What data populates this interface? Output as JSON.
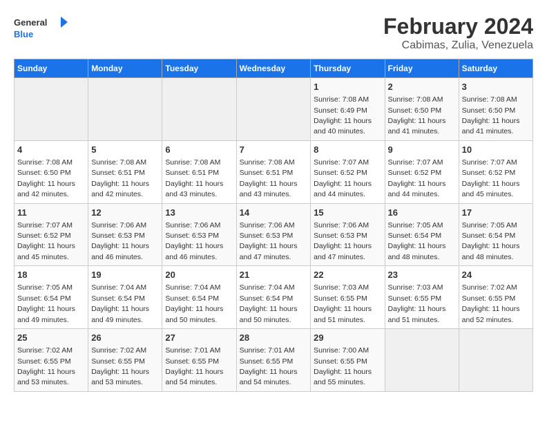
{
  "header": {
    "logo_line1": "General",
    "logo_line2": "Blue",
    "title": "February 2024",
    "subtitle": "Cabimas, Zulia, Venezuela"
  },
  "days_of_week": [
    "Sunday",
    "Monday",
    "Tuesday",
    "Wednesday",
    "Thursday",
    "Friday",
    "Saturday"
  ],
  "weeks": [
    [
      {
        "day": "",
        "info": ""
      },
      {
        "day": "",
        "info": ""
      },
      {
        "day": "",
        "info": ""
      },
      {
        "day": "",
        "info": ""
      },
      {
        "day": "1",
        "info": "Sunrise: 7:08 AM\nSunset: 6:49 PM\nDaylight: 11 hours and 40 minutes."
      },
      {
        "day": "2",
        "info": "Sunrise: 7:08 AM\nSunset: 6:50 PM\nDaylight: 11 hours and 41 minutes."
      },
      {
        "day": "3",
        "info": "Sunrise: 7:08 AM\nSunset: 6:50 PM\nDaylight: 11 hours and 41 minutes."
      }
    ],
    [
      {
        "day": "4",
        "info": "Sunrise: 7:08 AM\nSunset: 6:50 PM\nDaylight: 11 hours and 42 minutes."
      },
      {
        "day": "5",
        "info": "Sunrise: 7:08 AM\nSunset: 6:51 PM\nDaylight: 11 hours and 42 minutes."
      },
      {
        "day": "6",
        "info": "Sunrise: 7:08 AM\nSunset: 6:51 PM\nDaylight: 11 hours and 43 minutes."
      },
      {
        "day": "7",
        "info": "Sunrise: 7:08 AM\nSunset: 6:51 PM\nDaylight: 11 hours and 43 minutes."
      },
      {
        "day": "8",
        "info": "Sunrise: 7:07 AM\nSunset: 6:52 PM\nDaylight: 11 hours and 44 minutes."
      },
      {
        "day": "9",
        "info": "Sunrise: 7:07 AM\nSunset: 6:52 PM\nDaylight: 11 hours and 44 minutes."
      },
      {
        "day": "10",
        "info": "Sunrise: 7:07 AM\nSunset: 6:52 PM\nDaylight: 11 hours and 45 minutes."
      }
    ],
    [
      {
        "day": "11",
        "info": "Sunrise: 7:07 AM\nSunset: 6:52 PM\nDaylight: 11 hours and 45 minutes."
      },
      {
        "day": "12",
        "info": "Sunrise: 7:06 AM\nSunset: 6:53 PM\nDaylight: 11 hours and 46 minutes."
      },
      {
        "day": "13",
        "info": "Sunrise: 7:06 AM\nSunset: 6:53 PM\nDaylight: 11 hours and 46 minutes."
      },
      {
        "day": "14",
        "info": "Sunrise: 7:06 AM\nSunset: 6:53 PM\nDaylight: 11 hours and 47 minutes."
      },
      {
        "day": "15",
        "info": "Sunrise: 7:06 AM\nSunset: 6:53 PM\nDaylight: 11 hours and 47 minutes."
      },
      {
        "day": "16",
        "info": "Sunrise: 7:05 AM\nSunset: 6:54 PM\nDaylight: 11 hours and 48 minutes."
      },
      {
        "day": "17",
        "info": "Sunrise: 7:05 AM\nSunset: 6:54 PM\nDaylight: 11 hours and 48 minutes."
      }
    ],
    [
      {
        "day": "18",
        "info": "Sunrise: 7:05 AM\nSunset: 6:54 PM\nDaylight: 11 hours and 49 minutes."
      },
      {
        "day": "19",
        "info": "Sunrise: 7:04 AM\nSunset: 6:54 PM\nDaylight: 11 hours and 49 minutes."
      },
      {
        "day": "20",
        "info": "Sunrise: 7:04 AM\nSunset: 6:54 PM\nDaylight: 11 hours and 50 minutes."
      },
      {
        "day": "21",
        "info": "Sunrise: 7:04 AM\nSunset: 6:54 PM\nDaylight: 11 hours and 50 minutes."
      },
      {
        "day": "22",
        "info": "Sunrise: 7:03 AM\nSunset: 6:55 PM\nDaylight: 11 hours and 51 minutes."
      },
      {
        "day": "23",
        "info": "Sunrise: 7:03 AM\nSunset: 6:55 PM\nDaylight: 11 hours and 51 minutes."
      },
      {
        "day": "24",
        "info": "Sunrise: 7:02 AM\nSunset: 6:55 PM\nDaylight: 11 hours and 52 minutes."
      }
    ],
    [
      {
        "day": "25",
        "info": "Sunrise: 7:02 AM\nSunset: 6:55 PM\nDaylight: 11 hours and 53 minutes."
      },
      {
        "day": "26",
        "info": "Sunrise: 7:02 AM\nSunset: 6:55 PM\nDaylight: 11 hours and 53 minutes."
      },
      {
        "day": "27",
        "info": "Sunrise: 7:01 AM\nSunset: 6:55 PM\nDaylight: 11 hours and 54 minutes."
      },
      {
        "day": "28",
        "info": "Sunrise: 7:01 AM\nSunset: 6:55 PM\nDaylight: 11 hours and 54 minutes."
      },
      {
        "day": "29",
        "info": "Sunrise: 7:00 AM\nSunset: 6:55 PM\nDaylight: 11 hours and 55 minutes."
      },
      {
        "day": "",
        "info": ""
      },
      {
        "day": "",
        "info": ""
      }
    ]
  ]
}
